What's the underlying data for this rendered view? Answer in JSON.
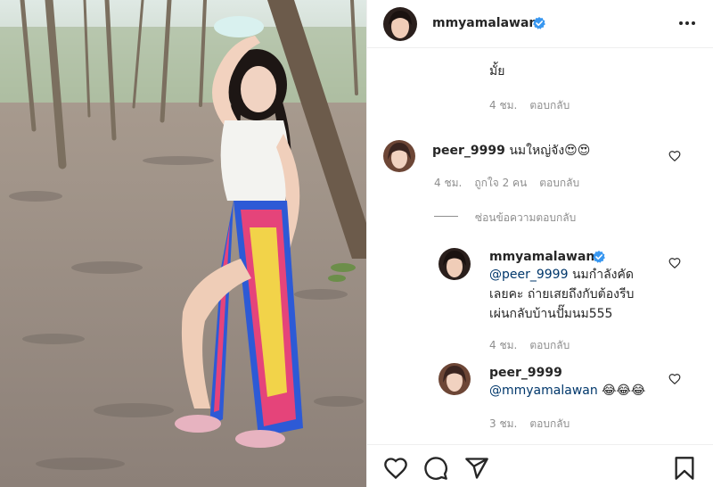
{
  "post": {
    "author": "mmyamalawan",
    "more_icon": "more-horizontal-icon"
  },
  "comments": {
    "trailing_text": "มั้ย",
    "trailing_meta": {
      "time": "4 ชม.",
      "reply": "ตอบกลับ"
    },
    "c1": {
      "username": "peer_9999",
      "text": "นมใหญ่จัง😍😍",
      "time": "4 ชม.",
      "likes": "ถูกใจ 2 คน",
      "reply": "ตอบกลับ"
    },
    "hide_replies": "ซ่อนข้อความตอบกลับ",
    "r1": {
      "username": "mmyamalawan",
      "mention": "@peer_9999",
      "line1": " นมกำลังคัด",
      "line2": "เลยคะ ถ่ายเสยถึงกับต้องรีบ",
      "line3": "เผ่นกลับบ้านปั๊มนม555",
      "time": "4 ชม.",
      "reply": "ตอบกลับ"
    },
    "r2": {
      "username": "peer_9999",
      "mention": "@mmyamalawan",
      "text": " 😂😂😂",
      "time": "3 ชม.",
      "reply": "ตอบกลับ"
    }
  },
  "actions": {
    "like": "heart-icon",
    "comment": "comment-icon",
    "share": "share-icon",
    "save": "bookmark-icon"
  },
  "colors": {
    "verified": "#3897f0",
    "mention": "#00376b",
    "meta": "#8e8e8e",
    "text": "#262626"
  }
}
